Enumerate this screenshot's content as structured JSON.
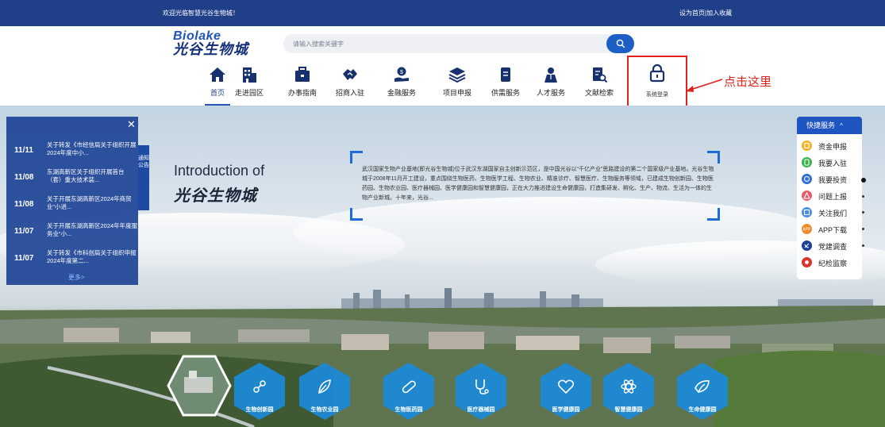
{
  "topbar": {
    "welcome": "欢迎光临智慧光谷生物城！",
    "set_home": "设为首页",
    "separator": "|",
    "add_favorite": "加入收藏"
  },
  "logo": {
    "en": "Biolake",
    "zh": "光谷生物城"
  },
  "search": {
    "placeholder": "请输入搜索关键字",
    "icon": "search-icon"
  },
  "nav": {
    "items": [
      {
        "label": "首页",
        "icon": "home-icon",
        "active": true
      },
      {
        "label": "走进园区",
        "icon": "building-icon"
      },
      {
        "label": "办事指南",
        "icon": "briefcase-icon"
      },
      {
        "label": "招商入驻",
        "icon": "handshake-icon"
      },
      {
        "label": "金融服务",
        "icon": "finance-icon"
      },
      {
        "label": "项目申报",
        "icon": "layers-icon"
      },
      {
        "label": "供需服务",
        "icon": "document-icon"
      },
      {
        "label": "人才服务",
        "icon": "person-icon"
      },
      {
        "label": "文献检索",
        "icon": "document-search-icon"
      }
    ],
    "login": {
      "label": "系统登录",
      "icon": "lock-icon"
    }
  },
  "annotation": {
    "text": "点击这里",
    "color": "#e0201a"
  },
  "news": {
    "tab_label": "通知公告",
    "items": [
      {
        "date": "11/11",
        "title": "关于转发《市经信局关于组织开展2024年度中小..."
      },
      {
        "date": "11/08",
        "title": "东湖高新区关于组织开展首台（套）重大技术装..."
      },
      {
        "date": "11/08",
        "title": "关于开展东湖高新区2024年商贸业“小进..."
      },
      {
        "date": "11/07",
        "title": "关于开展东湖高新区2024年年度服务业“小..."
      },
      {
        "date": "11/07",
        "title": "关于转发《市科创局关于组织申报2024年度第二..."
      }
    ],
    "more": "更多>"
  },
  "intro": {
    "title": "Introduction of",
    "subtitle": "光谷生物城",
    "text": "武汉国家生物产业基地(即光谷生物城)位于武汉东湖国家自主创新示范区，是中国光谷以“千亿产业”思路建设的第二个国家级产业基地。光谷生物城于2008年11月开工建设，重点围绕生物医药、生物医学工程、生物农业、精准诊疗、智慧医疗、生物服务等领域，已建成生物创新园、生物医药园、生物农业园、医疗器械园、医学健康园和智慧健康园，正在大力推进建设生命健康园，打造集研发、孵化、生产、物流、生活为一体的生物产业新城。十年来，光谷..."
  },
  "quick": {
    "title": "快捷服务",
    "toggle": "^",
    "items": [
      {
        "label": "资金申报",
        "icon": "fund-icon",
        "color": "#f0b323"
      },
      {
        "label": "我要入驻",
        "icon": "enter-icon",
        "color": "#3cb04a"
      },
      {
        "label": "我要投资",
        "icon": "invest-icon",
        "color": "#2f6fd6"
      },
      {
        "label": "问题上报",
        "icon": "warning-icon",
        "color": "#e8596a"
      },
      {
        "label": "关注我们",
        "icon": "follow-icon",
        "color": "#4a8fe0"
      },
      {
        "label": "APP下载",
        "icon": "app-icon",
        "color": "#f28a2a"
      },
      {
        "label": "党建调查",
        "icon": "party-icon",
        "color": "#1e3f9a"
      },
      {
        "label": "纪检监察",
        "icon": "inspection-icon",
        "color": "#d9342b"
      }
    ]
  },
  "parks": [
    {
      "label": "生物创新园",
      "icon": "molecule-icon"
    },
    {
      "label": "生物农业园",
      "icon": "leaf-icon"
    },
    {
      "label": "生物医药园",
      "icon": "pill-icon"
    },
    {
      "label": "医疗器械园",
      "icon": "stethoscope-icon"
    },
    {
      "label": "医学健康园",
      "icon": "heart-icon"
    },
    {
      "label": "智慧健康园",
      "icon": "atom-icon"
    },
    {
      "label": "生命健康园",
      "icon": "lifeleaf-icon"
    }
  ]
}
